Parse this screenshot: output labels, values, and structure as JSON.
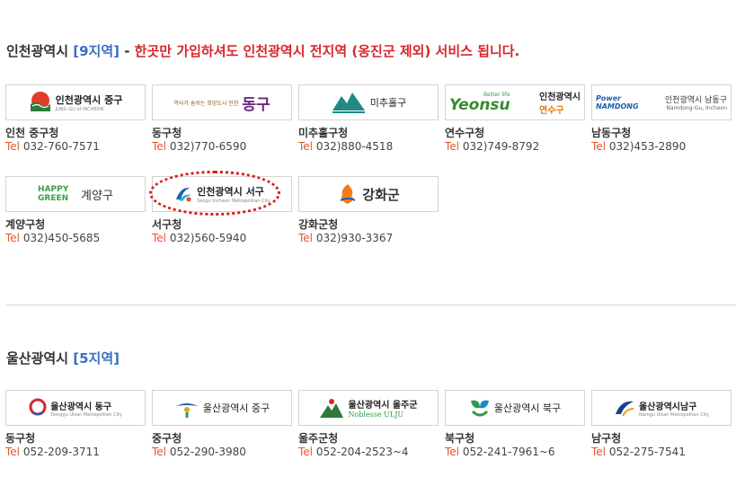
{
  "incheon": {
    "name": "인천광역시",
    "count": "[9지역]",
    "separator": " - ",
    "note": "한곳만 가입하셔도 인천광역시 전지역 (옹진군 제외) 서비스 됩니다.",
    "offices": [
      {
        "name": "인천 중구청",
        "tel_label": "Tel",
        "tel": "032-760-7571",
        "logo": {
          "text": "인천광역시 중구",
          "sub": "JUNG-GU of INCHEON",
          "icon": "jung-gu-sun-icon"
        }
      },
      {
        "name": "동구청",
        "tel_label": "Tel",
        "tel": "032)770-6590",
        "logo": {
          "text": "동구",
          "sub": "역사가 숨쉬는 희망도시 인천",
          "icon": "dong-gu-calligraphy-icon"
        }
      },
      {
        "name": "미추홀구청",
        "tel_label": "Tel",
        "tel": "032)880-4518",
        "logo": {
          "text": "미추홀구",
          "sub": "",
          "icon": "michuhol-mountain-icon"
        }
      },
      {
        "name": "연수구청",
        "tel_label": "Tel",
        "tel": "032)749-8792",
        "logo": {
          "text": "Yeonsu",
          "sub": "Better life",
          "extra": "인천광역시",
          "extra2": "연수구",
          "icon": "yeonsu-leaf-icon"
        }
      },
      {
        "name": "남동구청",
        "tel_label": "Tel",
        "tel": "032)453-2890",
        "logo": {
          "text": "인천광역시 남동구",
          "sub": "Namdong-Gu, Incheon",
          "badge": "Power NAMDONG",
          "icon": "namdong-power-icon"
        }
      },
      {
        "name": "계양구청",
        "tel_label": "Tel",
        "tel": "032)450-5685",
        "logo": {
          "text": "계양구",
          "sub": "HAPPY GREEN",
          "icon": "gyeyang-happy-green-icon"
        }
      },
      {
        "name": "서구청",
        "tel_label": "Tel",
        "tel": "032)560-5940",
        "logo": {
          "text": "인천광역시 서구",
          "sub": "Seogu Incheon Metropolitan City",
          "icon": "seo-gu-wave-icon"
        }
      },
      {
        "name": "강화군청",
        "tel_label": "Tel",
        "tel": "032)930-3367",
        "logo": {
          "text": "강화군",
          "sub": "",
          "icon": "ganghwa-flame-icon"
        }
      }
    ]
  },
  "ulsan": {
    "name": "울산광역시",
    "count": "[5지역]",
    "offices": [
      {
        "name": "동구청",
        "tel_label": "Tel",
        "tel": "052-209-3711",
        "logo": {
          "text": "울산광역시 동구",
          "sub": "Donggu Ulsan Metropolitan City",
          "icon": "ulsan-donggu-circle-icon"
        }
      },
      {
        "name": "중구청",
        "tel_label": "Tel",
        "tel": "052-290-3980",
        "logo": {
          "text": "울산광역시 중구",
          "sub": "",
          "icon": "ulsan-junggu-figure-icon"
        }
      },
      {
        "name": "울주군청",
        "tel_label": "Tel",
        "tel": "052-204-2523~4",
        "logo": {
          "text": "울산광역시 울주군",
          "sub": "Noblesse ULJU",
          "icon": "ulju-mountain-icon"
        }
      },
      {
        "name": "북구청",
        "tel_label": "Tel",
        "tel": "052-241-7961~6",
        "logo": {
          "text": "울산광역시 북구",
          "sub": "",
          "icon": "ulsan-bukgu-leaf-icon"
        }
      },
      {
        "name": "남구청",
        "tel_label": "Tel",
        "tel": "052-275-7541",
        "logo": {
          "text": "울산광역시남구",
          "sub": "Namgu Ulsan Metropolitan City",
          "icon": "ulsan-namgu-swoosh-icon"
        }
      }
    ]
  },
  "colors": {
    "accent_blue": "#3a6fc4",
    "alert_red": "#d8262b",
    "tel_orange": "#e2572b",
    "highlight": "#e01818"
  }
}
